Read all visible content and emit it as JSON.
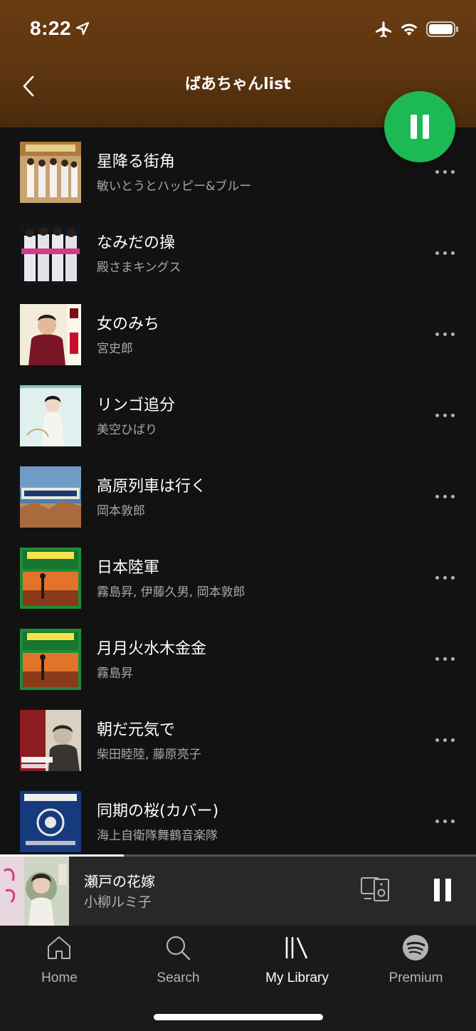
{
  "status_bar": {
    "time": "8:22",
    "icons": [
      "location-arrow-icon",
      "airplane-icon",
      "wifi-icon",
      "battery-icon"
    ]
  },
  "header": {
    "title": "ばあちゃんlist",
    "back_icon": "chevron-left-icon",
    "play_state": "playing"
  },
  "colors": {
    "header_brown": "#6a3c12",
    "accent_green": "#1db954",
    "background": "#121212"
  },
  "tracks": [
    {
      "title": "星降る街角",
      "artist": "敏いとうとハッピー&ブルー"
    },
    {
      "title": "なみだの操",
      "artist": "殿さまキングス"
    },
    {
      "title": "女のみち",
      "artist": "宮史郎"
    },
    {
      "title": "リンゴ追分",
      "artist": "美空ひばり"
    },
    {
      "title": "高原列車は行く",
      "artist": "岡本敦郎"
    },
    {
      "title": "日本陸軍",
      "artist": "霧島昇, 伊藤久男, 岡本敦郎"
    },
    {
      "title": "月月火水木金金",
      "artist": "霧島昇"
    },
    {
      "title": "朝だ元気で",
      "artist": "柴田睦陸, 藤原亮子"
    },
    {
      "title": "同期の桜(カバー)",
      "artist": "海上自衛隊舞鶴音楽隊"
    }
  ],
  "now_playing": {
    "title": "瀬戸の花嫁",
    "artist": "小柳ルミ子",
    "progress": 0.26
  },
  "tab_bar": {
    "tabs": [
      {
        "label": "Home",
        "icon": "home-icon",
        "active": false
      },
      {
        "label": "Search",
        "icon": "search-icon",
        "active": false
      },
      {
        "label": "My Library",
        "icon": "library-icon",
        "active": true
      },
      {
        "label": "Premium",
        "icon": "spotify-icon",
        "active": false
      }
    ]
  }
}
